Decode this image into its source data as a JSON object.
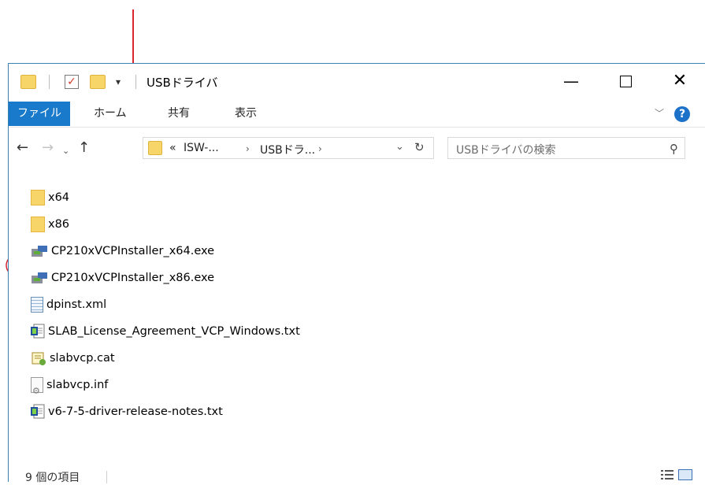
{
  "window": {
    "title": "USBドライバ",
    "minimize_glyph": "—",
    "close_glyph": "✕",
    "quick_access_dropdown": "▾"
  },
  "ribbon": {
    "tabs": [
      {
        "label": "ファイル"
      },
      {
        "label": "ホーム"
      },
      {
        "label": "共有"
      },
      {
        "label": "表示"
      }
    ],
    "expand_glyph": "﹀",
    "help_glyph": "?"
  },
  "navigation": {
    "back_glyph": "←",
    "forward_glyph": "→",
    "recent_glyph": "⌄",
    "up_glyph": "↑",
    "breadcrumbs": [
      "«",
      "ISW-...",
      "›",
      "USBドラ...",
      "›"
    ],
    "dropdown_glyph": "⌄",
    "refresh_glyph": "↻",
    "search_placeholder": "USBドライバの検索",
    "search_glyph": "⚲"
  },
  "files": [
    {
      "name": "x64",
      "type": "folder"
    },
    {
      "name": "x86",
      "type": "folder"
    },
    {
      "name": "CP210xVCPInstaller_x64.exe",
      "type": "exe"
    },
    {
      "name": "CP210xVCPInstaller_x86.exe",
      "type": "exe"
    },
    {
      "name": "dpinst.xml",
      "type": "xml"
    },
    {
      "name": "SLAB_License_Agreement_VCP_Windows.txt",
      "type": "txt"
    },
    {
      "name": "slabvcp.cat",
      "type": "cat"
    },
    {
      "name": "slabvcp.inf",
      "type": "inf"
    },
    {
      "name": "v6-7-5-driver-release-notes.txt",
      "type": "txt"
    }
  ],
  "status": {
    "item_count": "9 個の項目"
  },
  "colors": {
    "annotation": "#d9262b",
    "ribbon_file_tab": "#1979ca",
    "folder": "#f8d568"
  }
}
